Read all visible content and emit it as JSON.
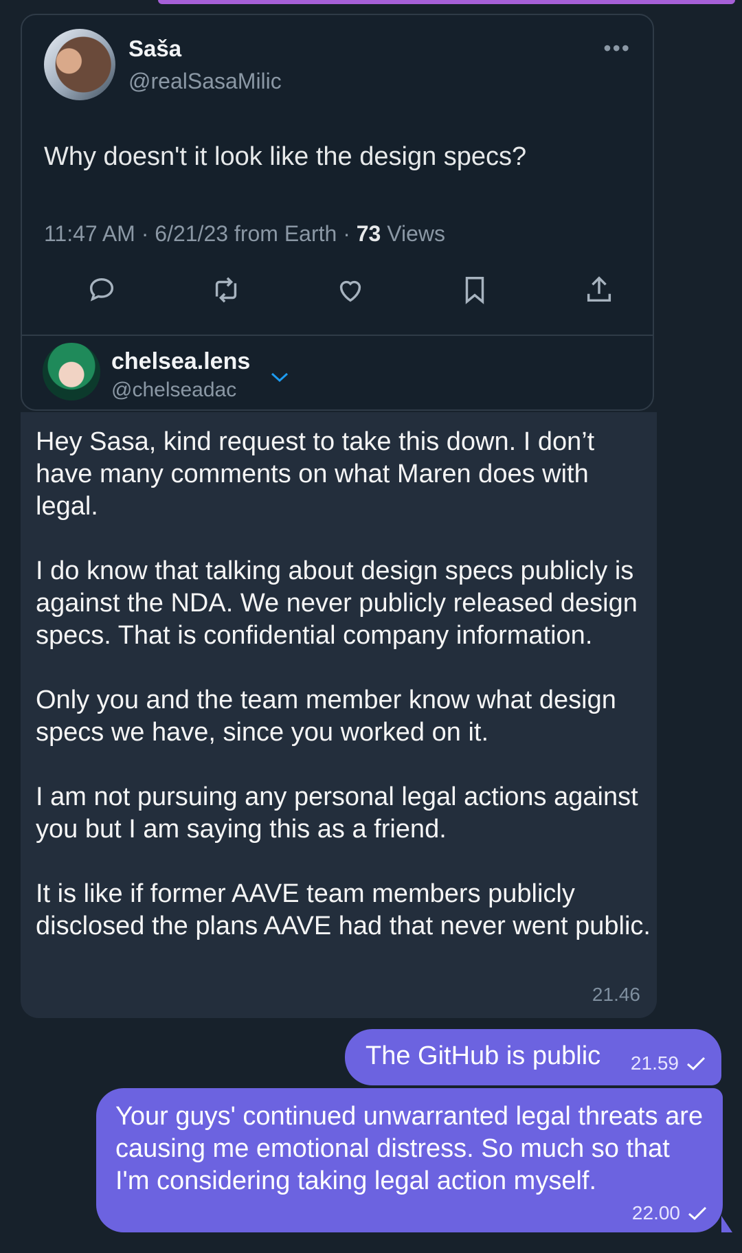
{
  "tweet": {
    "name": "Saša",
    "handle": "@realSasaMilic",
    "text": "Why doesn't it look like the design specs?",
    "meta_time": "11:47 AM · 6/21/23 from Earth · ",
    "views_count": "73",
    "views_label": " Views"
  },
  "quote": {
    "name": "chelsea.lens",
    "handle": "@chelseadac"
  },
  "incoming": {
    "text": "Hey Sasa, kind request to take this down. I don’t have many comments on what Maren does with legal.\n\nI do know that talking about design specs publicly is against the NDA. We never publicly released design specs. That is confidential company information.\n\nOnly you and the team member know what design specs we have, since you worked on it.\n\nI am not pursuing any personal legal actions against you but I am saying this as a friend.\n\nIt is like if former AAVE team members publicly disclosed the plans AAVE had that never went public.",
    "time": "21.46"
  },
  "outgoing": [
    {
      "text": "The GitHub is public",
      "time": "21.59"
    },
    {
      "text": "Your guys' continued unwarranted legal threats are causing me emotional distress. So much so that I'm considering taking legal action myself.",
      "time": "22.00"
    }
  ],
  "colors": {
    "background": "#17212b",
    "incoming_bubble": "#232e3c",
    "outgoing_bubble": "#6c63e0",
    "twitter_blue": "#1d9bf0"
  },
  "icons": [
    "more-icon",
    "reply-icon",
    "retweet-icon",
    "like-icon",
    "bookmark-icon",
    "share-icon",
    "chevron-down-icon",
    "check-icon"
  ]
}
